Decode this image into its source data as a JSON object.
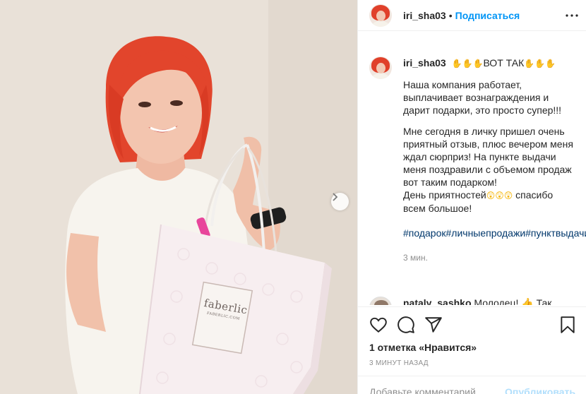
{
  "photo": {
    "bag_brand": "faberlic",
    "bag_subtitle": "FABERLIC.COM",
    "next_icon": "chevron-right-icon"
  },
  "header": {
    "username": "iri_sha03",
    "separator": "•",
    "follow_label": "Подписаться",
    "more_icon": "more-horizontal-icon"
  },
  "caption": {
    "username": "iri_sha03",
    "emoji_before": "✋✋✋",
    "headline": "ВОТ ТАК",
    "emoji_after": "✋✋✋",
    "paragraph1": "Наша компания работает, выплачивает вознаграждения и дарит подарки, это просто супер!!!",
    "paragraph2": "Мне сегодня в личку пришел очень приятный отзыв, плюс вечером меня ждал сюрприз! На пункте выдачи меня поздравили с объемом продаж вот таким подарком!",
    "paragraph3_start": "День приятностей",
    "paragraph3_emoji": "😲😲😲",
    "paragraph3_end": " спасибо всем большое!",
    "hashtags": "#подарок#личныепродажи#пунктвыдачи#радость#отзывы#",
    "time": "3 мин."
  },
  "comment": {
    "username": "nataly_sashko",
    "text": "Молодец! 👍 Так"
  },
  "actions": {
    "like_icon": "heart-icon",
    "comment_icon": "comment-icon",
    "share_icon": "share-icon",
    "save_icon": "bookmark-icon"
  },
  "likes_text": "1 отметка «Нравится»",
  "post_time": "3 МИНУТ НАЗАД",
  "add_comment": {
    "placeholder": "Добавьте комментарий...",
    "publish_label": "Опубликовать"
  }
}
